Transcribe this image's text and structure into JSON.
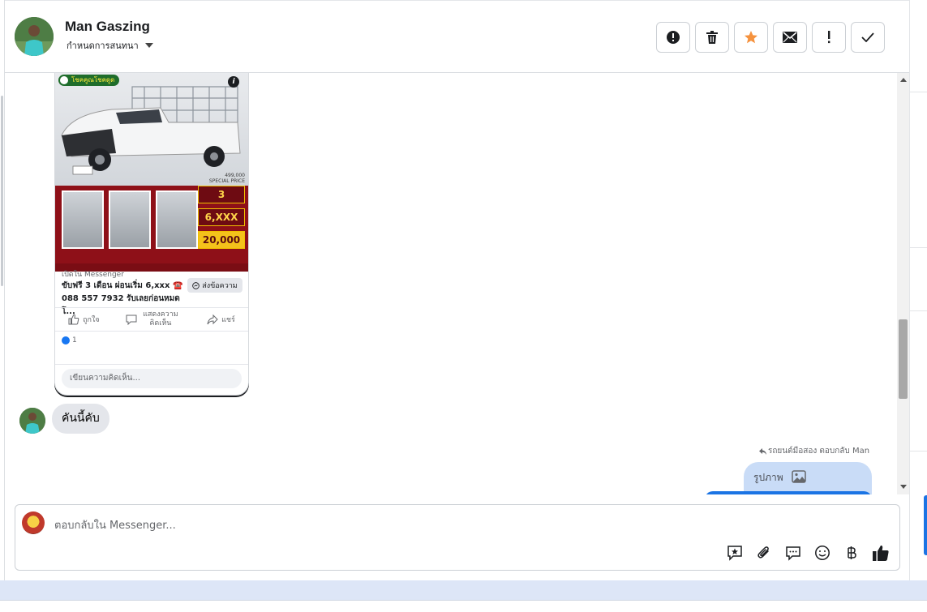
{
  "header": {
    "contact_name": "Man Gaszing",
    "assign_label": "กำหนดการสนทนา",
    "toolbar": [
      {
        "name": "mark-spam-button",
        "icon": "alert-circle-icon"
      },
      {
        "name": "delete-button",
        "icon": "trash-icon"
      },
      {
        "name": "star-button",
        "icon": "star-icon",
        "color": "#f5923e"
      },
      {
        "name": "mark-unread-button",
        "icon": "envelope-icon"
      },
      {
        "name": "follow-up-button",
        "icon": "exclamation-icon"
      },
      {
        "name": "mark-done-button",
        "icon": "checkmark-icon"
      }
    ]
  },
  "ad": {
    "brand": "โชคคูณโชคดูด",
    "price_text": "499,000",
    "special_price": "SPECIAL PRICE",
    "box1": "3",
    "box2": "6,XXX",
    "box3": "20,000",
    "opened_in": "เปิดใน Messenger",
    "headline": "ขับฟรี 3 เดือน ผ่อนเริ่ม 6,xxx ☎️ 088 557 7932 รับเลยก่อนหมดโ...",
    "send_button": "ส่งข้อความ",
    "like_label": "ถูกใจ",
    "comment_label": "แสดงความคิดเห็น",
    "share_label": "แชร์",
    "like_count": "1",
    "comment_placeholder": "เขียนความคิดเห็น..."
  },
  "messages": {
    "incoming_text": "คันนี้คับ",
    "reply_meta": "รถยนต์มือสอง ตอบกลับ Man",
    "outgoing_attachment_label": "รูปภาพ"
  },
  "composer": {
    "placeholder": "ตอบกลับใน Messenger...",
    "tools": [
      "saved-reply-icon",
      "paperclip-icon",
      "chat-bubble-icon",
      "emoji-icon",
      "baht-icon",
      "thumbs-up-icon"
    ]
  },
  "colors": {
    "accent": "#1b74e4",
    "star": "#f5923e",
    "ad_red": "#8e1018"
  }
}
